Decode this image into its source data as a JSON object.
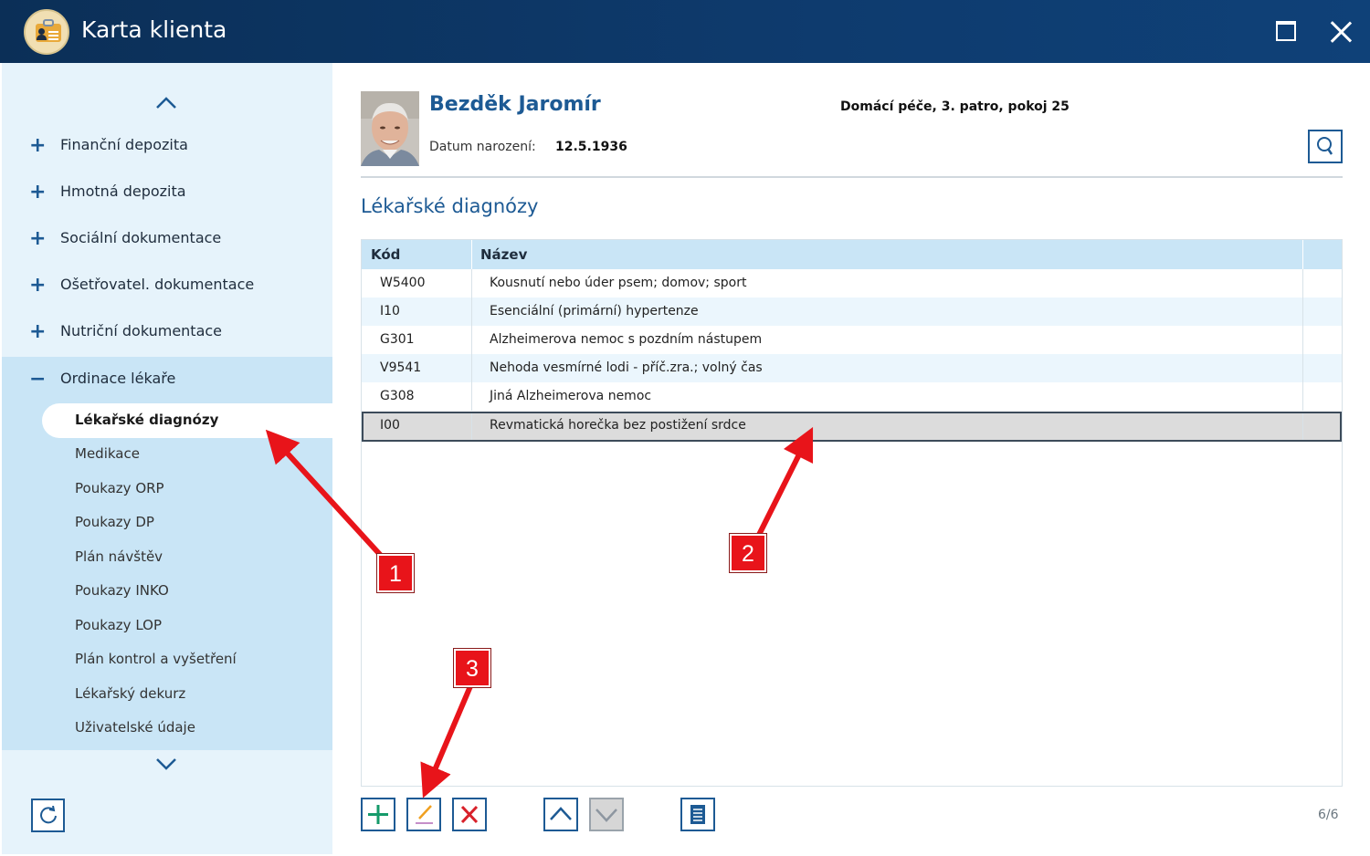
{
  "window": {
    "title": "Karta klienta"
  },
  "sidebar": {
    "sections": [
      {
        "label": "Finanční depozita",
        "expanded": false
      },
      {
        "label": "Hmotná depozita",
        "expanded": false
      },
      {
        "label": "Sociální dokumentace",
        "expanded": false
      },
      {
        "label": "Ošetřovatel. dokumentace",
        "expanded": false
      },
      {
        "label": "Nutriční dokumentace",
        "expanded": false
      },
      {
        "label": "Ordinace lékaře",
        "expanded": true
      }
    ],
    "subitems": [
      {
        "label": "Lékařské diagnózy",
        "active": true
      },
      {
        "label": "Medikace"
      },
      {
        "label": "Poukazy ORP"
      },
      {
        "label": "Poukazy DP"
      },
      {
        "label": "Plán návštěv"
      },
      {
        "label": "Poukazy INKO"
      },
      {
        "label": "Poukazy LOP"
      },
      {
        "label": "Plán kontrol a vyšetření"
      },
      {
        "label": "Lékařský dekurz"
      },
      {
        "label": "Uživatelské údaje"
      }
    ]
  },
  "patient": {
    "name": "Bezděk Jaromír",
    "birth_label": "Datum narození:",
    "birth_date": "12.5.1936",
    "location": "Domácí péče, 3. patro, pokoj 25"
  },
  "section_title": "Lékařské diagnózy",
  "table": {
    "columns": [
      "Kód",
      "Název"
    ],
    "rows": [
      {
        "code": "W5400",
        "name": "Kousnutí nebo úder psem; domov; sport"
      },
      {
        "code": "I10",
        "name": "Esenciální (primární) hypertenze"
      },
      {
        "code": "G301",
        "name": "Alzheimerova nemoc s pozdním nástupem"
      },
      {
        "code": "V9541",
        "name": "Nehoda vesmírné lodi - příč.zra.; volný čas"
      },
      {
        "code": "G308",
        "name": "Jiná Alzheimerova nemoc"
      },
      {
        "code": "I00",
        "name": "Revmatická horečka bez postižení srdce",
        "selected": true
      }
    ]
  },
  "toolbar": {
    "buttons": [
      "add-icon",
      "edit-icon",
      "delete-icon",
      "move-up-icon",
      "move-down-icon",
      "report-icon"
    ],
    "counter": "6/6"
  },
  "annotations": [
    "1",
    "2",
    "3"
  ],
  "colors": {
    "titlebar": "#0e3b6e",
    "accent": "#1d5a94",
    "sidebar": "#e6f3fb",
    "sidebar_open": "#c9e5f6",
    "annotation": "#e8141a"
  }
}
